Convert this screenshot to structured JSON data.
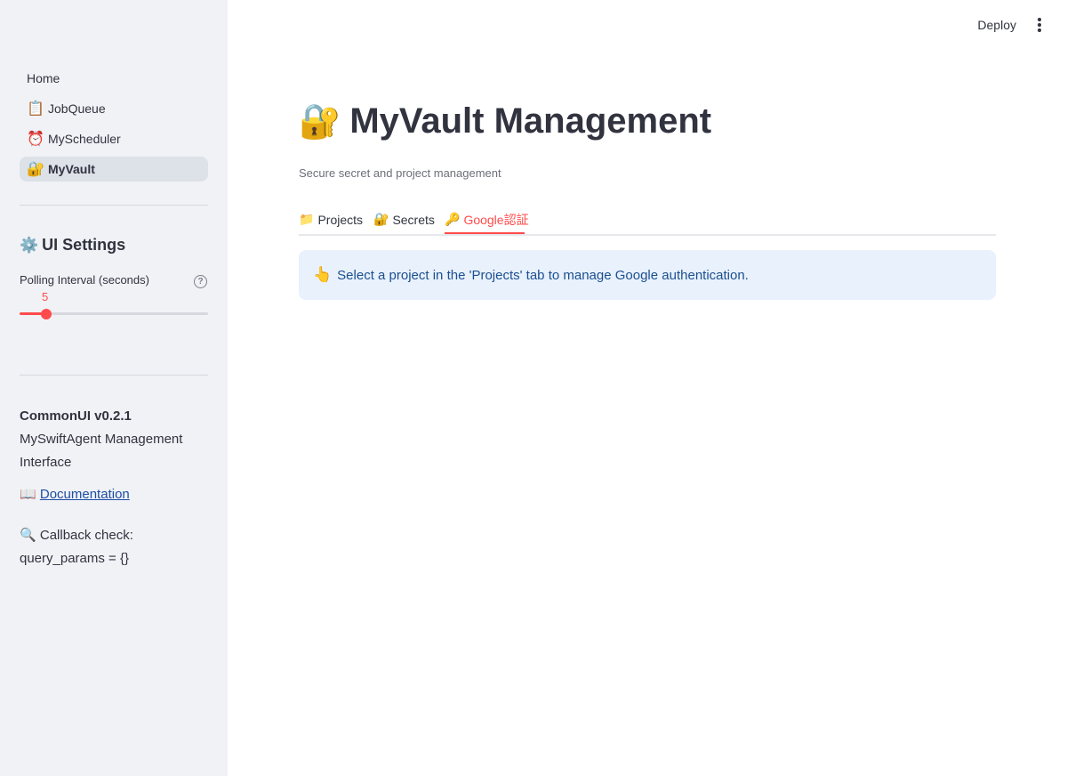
{
  "sidebar": {
    "nav": [
      {
        "label": "Home",
        "icon": ""
      },
      {
        "label": "JobQueue",
        "icon": "📋"
      },
      {
        "label": "MyScheduler",
        "icon": "⏰"
      },
      {
        "label": "MyVault",
        "icon": "🔐",
        "active": true
      }
    ],
    "settings_title": "UI Settings",
    "settings_icon": "⚙️",
    "polling": {
      "label": "Polling Interval (seconds)",
      "value": "5",
      "fraction": 0.14
    },
    "version": "CommonUI v0.2.1",
    "app_desc": "MySwiftAgent Management Interface",
    "doc_icon": "📖",
    "doc_link": "Documentation",
    "callback_icon": "🔍",
    "callback_line1": "Callback check:",
    "callback_line2": "query_params = {}"
  },
  "header": {
    "deploy_label": "Deploy"
  },
  "main": {
    "title_icon": "🔐",
    "title": "MyVault Management",
    "subtitle": "Secure secret and project management",
    "tabs": [
      {
        "icon": "📁",
        "label": "Projects"
      },
      {
        "icon": "🔐",
        "label": "Secrets"
      },
      {
        "icon": "🔑",
        "label": "Google認証",
        "active": true
      }
    ],
    "info_icon": "👆",
    "info_text": "Select a project in the 'Projects' tab to manage Google authentication."
  },
  "colors": {
    "accent": "#ff4b4b",
    "sidebar_bg": "#f0f2f6",
    "info_bg": "#e8f1fc",
    "info_text": "#1c4f8f"
  }
}
